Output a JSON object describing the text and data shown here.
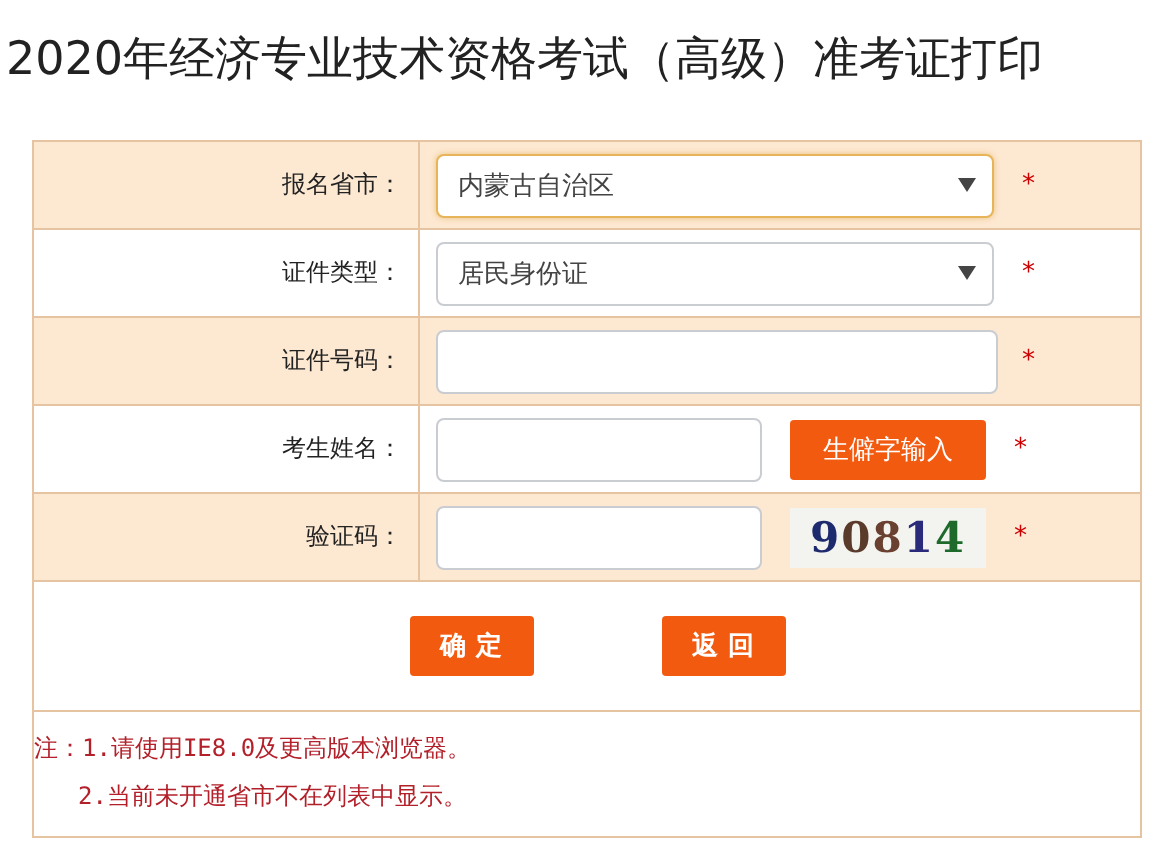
{
  "title": "2020年经济专业技术资格考试（高级）准考证打印",
  "rows": [
    {
      "kind": "select",
      "label": "报名省市：",
      "value": "内蒙古自治区",
      "focused": true,
      "mark": "*"
    },
    {
      "kind": "select",
      "label": "证件类型：",
      "value": "居民身份证",
      "focused": false,
      "mark": "*"
    },
    {
      "kind": "text",
      "label": "证件号码：",
      "mark": "*"
    },
    {
      "kind": "text_button",
      "label": "考生姓名：",
      "button": "生僻字输入",
      "mark": "*"
    },
    {
      "kind": "captcha",
      "label": "验证码：",
      "captcha": "90814",
      "mark": "*"
    }
  ],
  "buttons": [
    "确 定",
    "返 回"
  ],
  "notes": [
    "注：1.请使用IE8.0及更高版本浏览器。",
    "2.当前未开通省市不在列表中显示。"
  ]
}
